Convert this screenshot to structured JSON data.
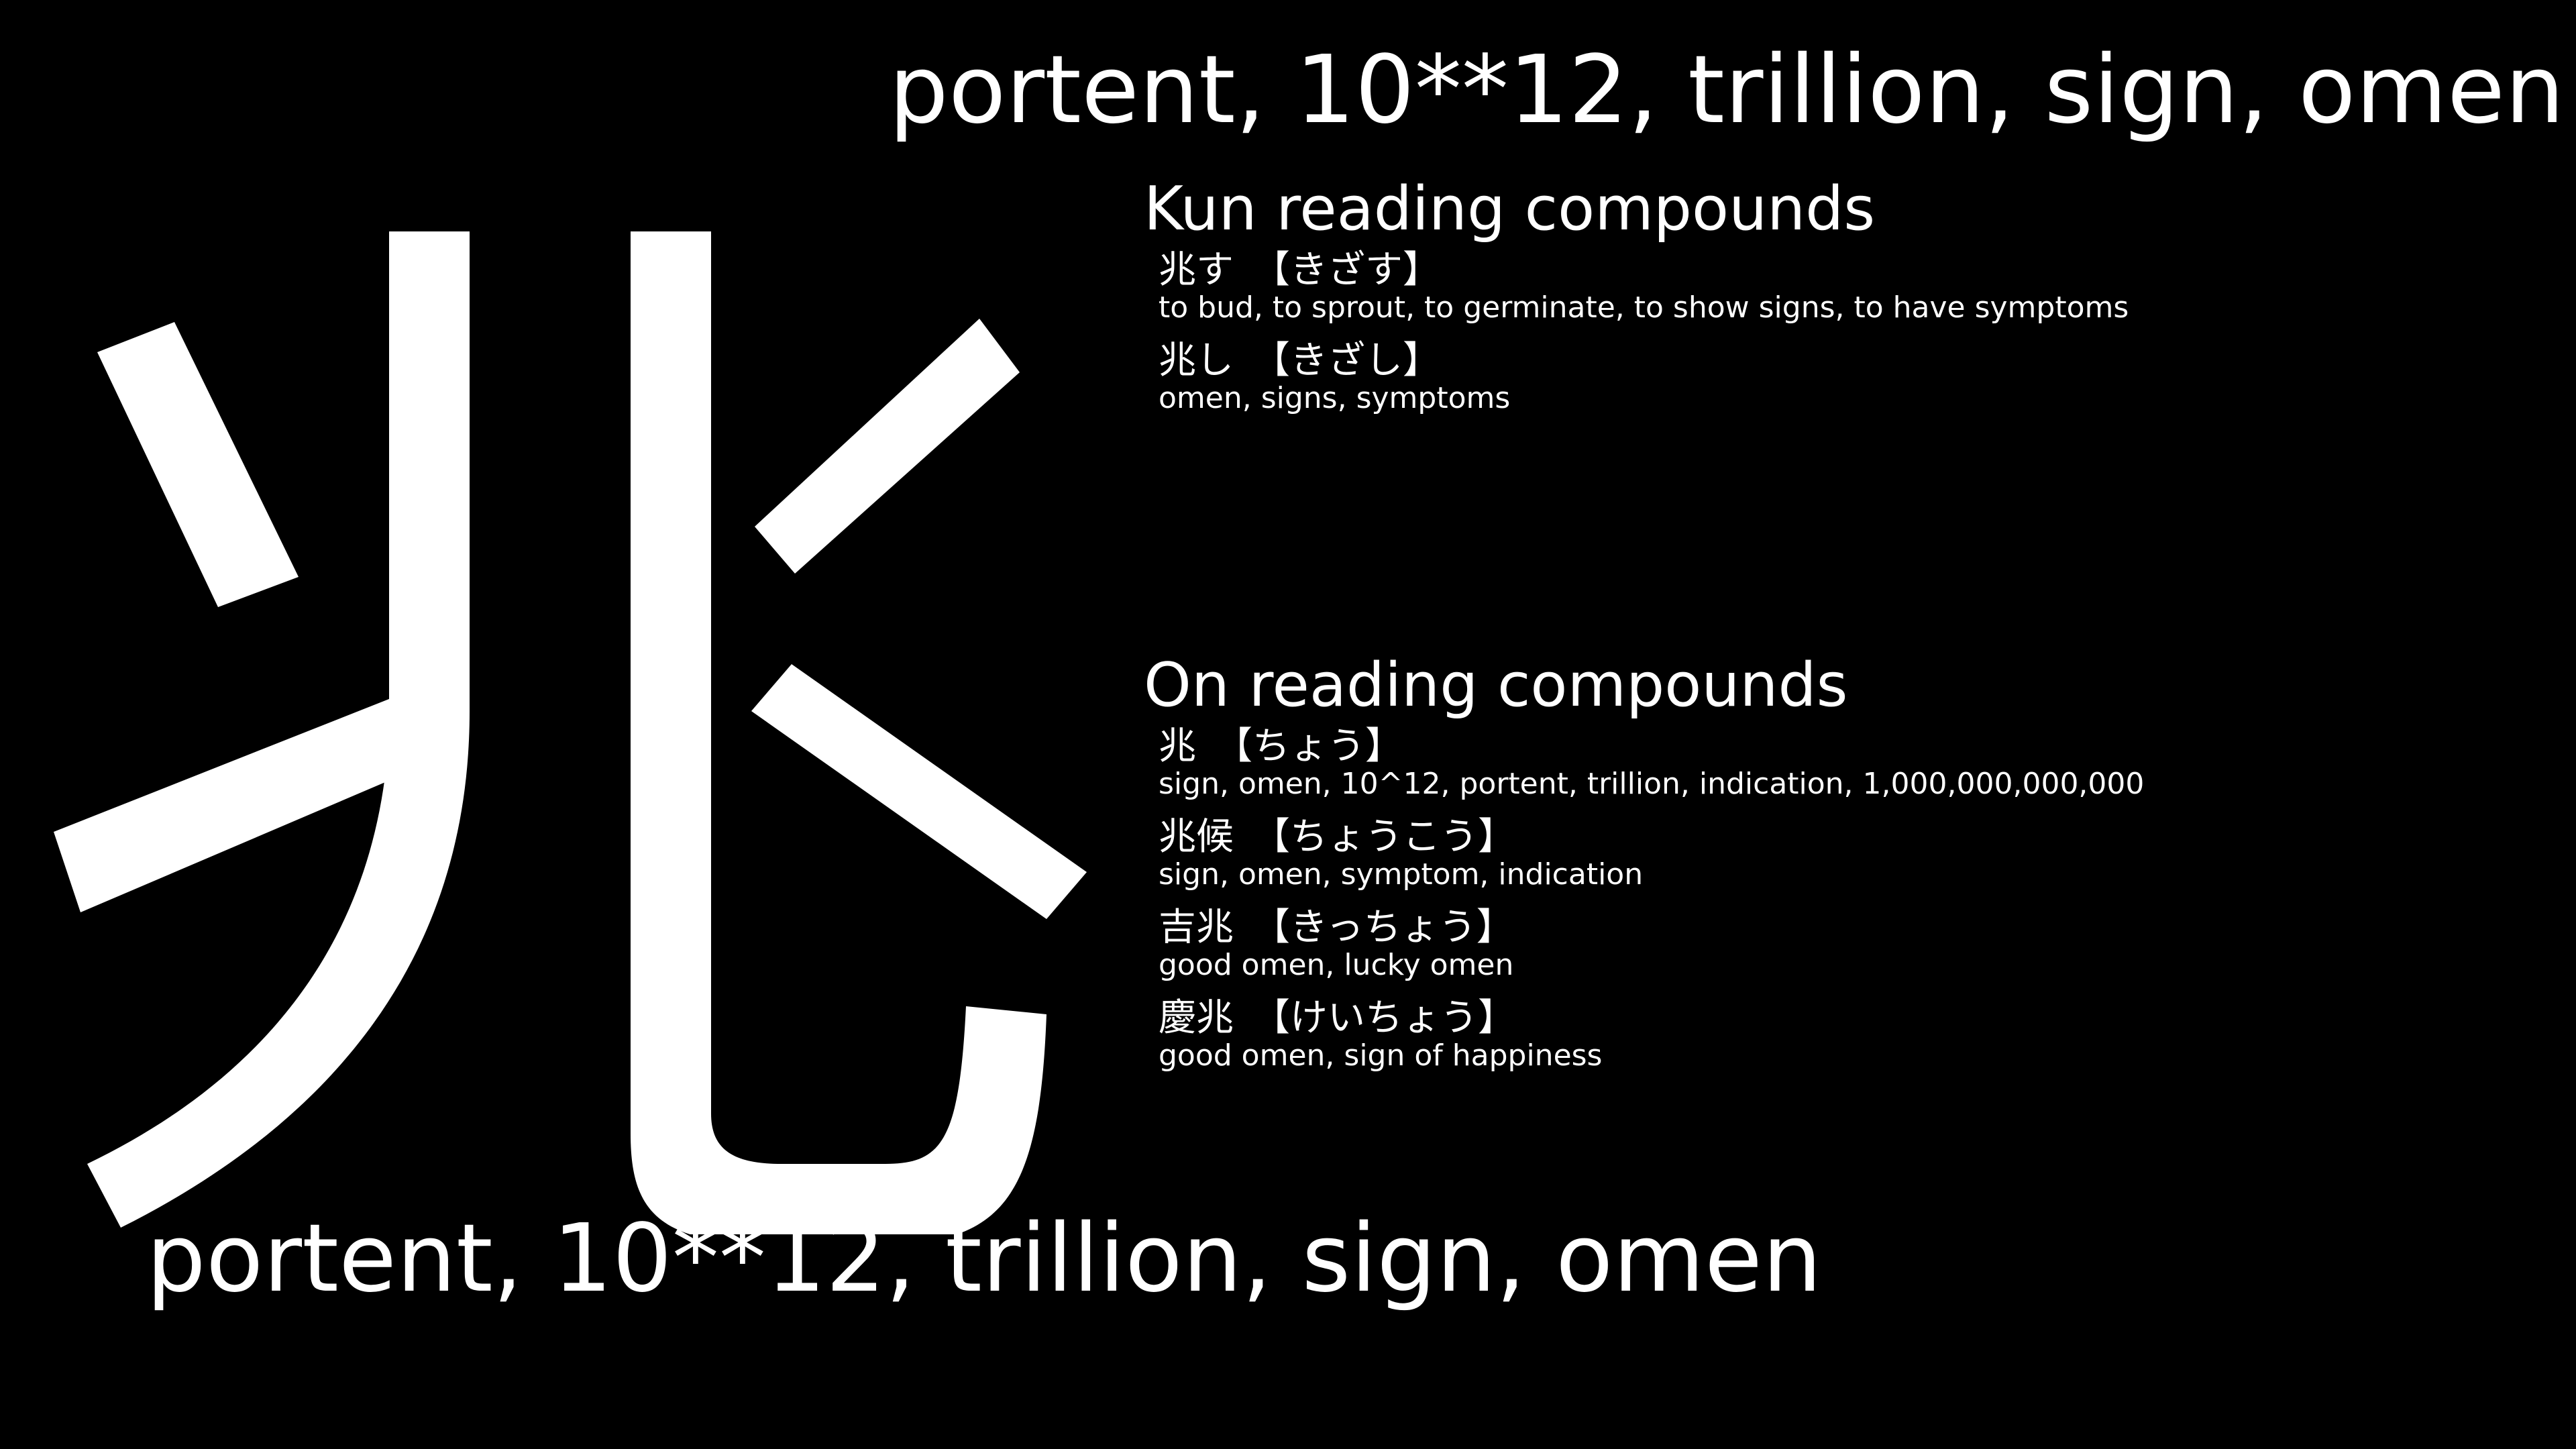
{
  "kanji": {
    "character": "兆",
    "icon": "kanji-glyph-cho"
  },
  "top_meaning": "portent, 10**12, trillion, sign, omen",
  "bottom_meaning": "portent, 10**12, trillion, sign, omen",
  "kun": {
    "heading": "Kun reading compounds",
    "compounds": [
      {
        "word": "兆す",
        "reading": "【きざす】",
        "meaning": "to bud, to sprout, to germinate, to show signs, to have symptoms"
      },
      {
        "word": "兆し",
        "reading": "【きざし】",
        "meaning": "omen, signs, symptoms"
      }
    ]
  },
  "on": {
    "heading": "On reading compounds",
    "compounds": [
      {
        "word": "兆",
        "reading": "【ちょう】",
        "meaning": "sign, omen, 10^12, portent, trillion, indication, 1,000,000,000,000"
      },
      {
        "word": "兆候",
        "reading": "【ちょうこう】",
        "meaning": "sign, omen, symptom, indication"
      },
      {
        "word": "吉兆",
        "reading": "【きっちょう】",
        "meaning": "good omen, lucky omen"
      },
      {
        "word": "慶兆",
        "reading": "【けいちょう】",
        "meaning": "good omen, sign of happiness"
      }
    ]
  },
  "colors": {
    "background": "#000000",
    "text": "#ffffff"
  }
}
